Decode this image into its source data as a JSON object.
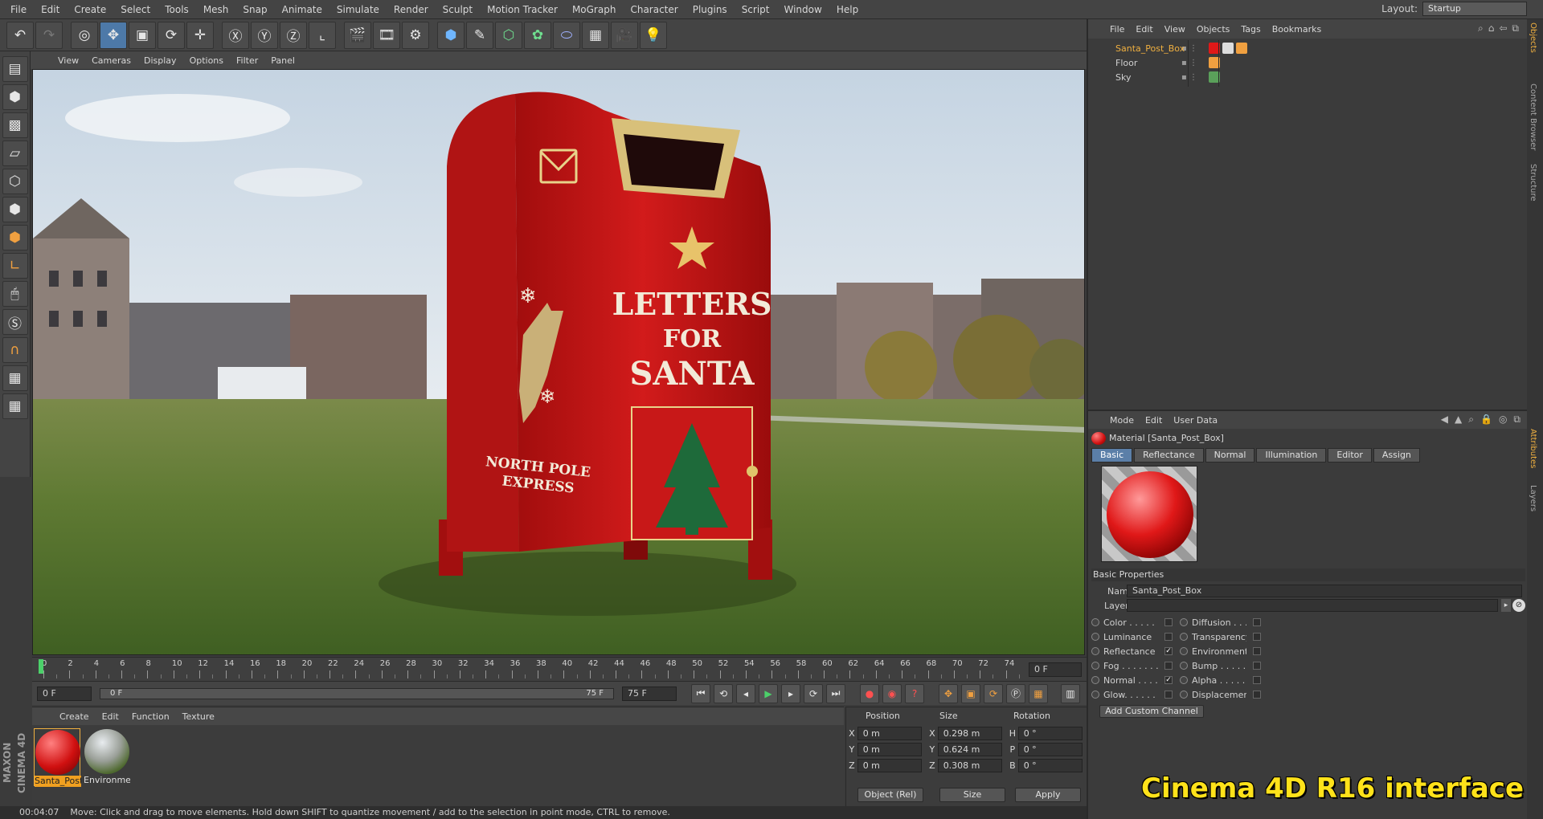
{
  "menubar": [
    "File",
    "Edit",
    "Create",
    "Select",
    "Tools",
    "Mesh",
    "Snap",
    "Animate",
    "Simulate",
    "Render",
    "Sculpt",
    "Motion Tracker",
    "MoGraph",
    "Character",
    "Plugins",
    "Script",
    "Window",
    "Help"
  ],
  "layout": {
    "label": "Layout:",
    "value": "Startup"
  },
  "viewport_menu": [
    "View",
    "Cameras",
    "Display",
    "Options",
    "Filter",
    "Panel"
  ],
  "mailbox": {
    "line1": "LETTERS",
    "line2": "FOR",
    "line3": "SANTA",
    "side1": "NORTH POLE",
    "side2": "EXPRESS"
  },
  "timeline": {
    "ticks": [
      "0",
      "2",
      "4",
      "6",
      "8",
      "10",
      "12",
      "14",
      "16",
      "18",
      "20",
      "22",
      "24",
      "26",
      "28",
      "30",
      "32",
      "34",
      "36",
      "38",
      "40",
      "42",
      "44",
      "46",
      "48",
      "50",
      "52",
      "54",
      "56",
      "58",
      "60",
      "62",
      "64",
      "66",
      "68",
      "70",
      "72",
      "74"
    ],
    "current_frame": "0 F"
  },
  "playback": {
    "start": "0 F",
    "slider_left": "0 F",
    "slider_right": "75 F",
    "end": "75 F"
  },
  "material_menu": [
    "Create",
    "Edit",
    "Function",
    "Texture"
  ],
  "materials": [
    {
      "name": "Santa_Post"
    },
    {
      "name": "Environmen"
    }
  ],
  "coords": {
    "headers": {
      "position": "Position",
      "size": "Size",
      "rotation": "Rotation"
    },
    "rows": [
      {
        "axis": "X",
        "pos": "0 m",
        "saxis": "X",
        "size": "0.298 m",
        "raxis": "H",
        "rot": "0 °"
      },
      {
        "axis": "Y",
        "pos": "0 m",
        "saxis": "Y",
        "size": "0.624 m",
        "raxis": "P",
        "rot": "0 °"
      },
      {
        "axis": "Z",
        "pos": "0 m",
        "saxis": "Z",
        "size": "0.308 m",
        "raxis": "B",
        "rot": "0 °"
      }
    ],
    "mode": "Object (Rel)",
    "size_mode": "Size",
    "apply": "Apply"
  },
  "status": {
    "time": "00:04:07",
    "message": "Move: Click and drag to move elements. Hold down SHIFT to quantize movement / add to the selection in point mode, CTRL to remove."
  },
  "object_menu": [
    "File",
    "Edit",
    "View",
    "Objects",
    "Tags",
    "Bookmarks"
  ],
  "objects": [
    {
      "name": "Santa_Post_Box"
    },
    {
      "name": "Floor"
    },
    {
      "name": "Sky"
    }
  ],
  "attr_menu": [
    "Mode",
    "Edit",
    "User Data"
  ],
  "material_title": "Material [Santa_Post_Box]",
  "tabs": [
    "Basic",
    "Reflectance",
    "Normal",
    "Illumination",
    "Editor",
    "Assign"
  ],
  "basic_properties": "Basic Properties",
  "name_label": "Name",
  "name_value": "Santa_Post_Box",
  "layer_label": "Layer",
  "channels_left": [
    {
      "label": "Color . . . . . .",
      "checked": ""
    },
    {
      "label": "Luminance",
      "checked": ""
    },
    {
      "label": "Reflectance",
      "checked": "✓"
    },
    {
      "label": "Fog . . . . . . . .",
      "checked": ""
    },
    {
      "label": "Normal . . . .",
      "checked": "✓"
    },
    {
      "label": "Glow. . . . . . .",
      "checked": ""
    }
  ],
  "channels_right": [
    {
      "label": "Diffusion . . .",
      "checked": ""
    },
    {
      "label": "Transparency",
      "checked": ""
    },
    {
      "label": "Environment",
      "checked": ""
    },
    {
      "label": "Bump . . . . . .",
      "checked": ""
    },
    {
      "label": "Alpha . . . . . .",
      "checked": ""
    },
    {
      "label": "Displacement",
      "checked": ""
    }
  ],
  "add_channel": "Add Custom Channel",
  "side_tabs": [
    "Objects",
    "Content Browser",
    "Structure",
    "Attributes",
    "Layers"
  ],
  "brand": "MAXON CINEMA 4D",
  "watermark": "Cinema 4D R16 interface",
  "colors": {
    "accent": "#5b7fa8",
    "selected_object": "#f0b040",
    "mailbox_red": "#c41616",
    "watermark": "#ffe21a"
  }
}
